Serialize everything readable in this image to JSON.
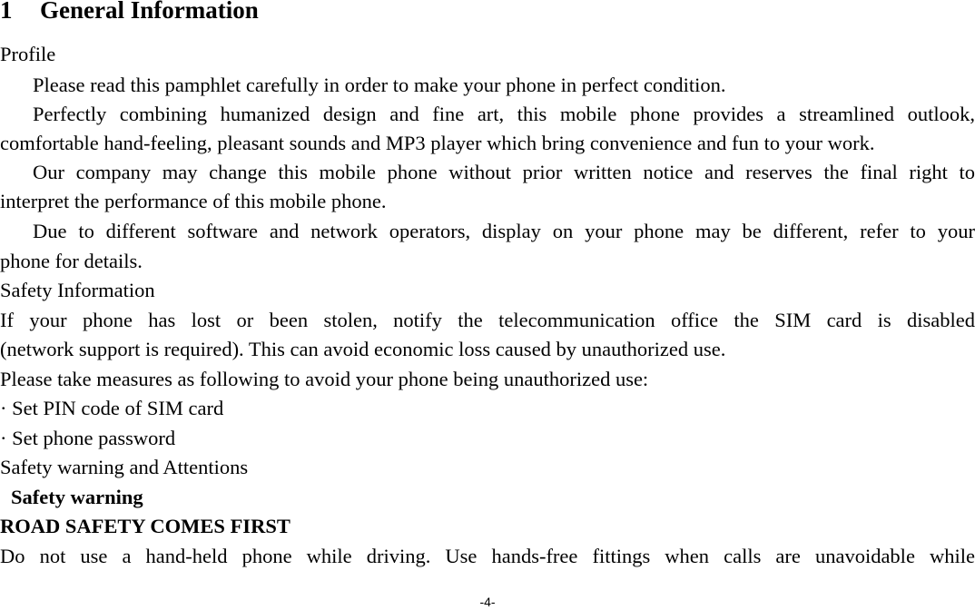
{
  "heading": {
    "number": "1",
    "title": "General Information"
  },
  "lines": [
    "Profile",
    "Please read this pamphlet carefully in order to make your phone in perfect condition.",
    "Perfectly combining humanized design and fine art, this mobile phone provides a streamlined outlook,",
    "comfortable hand-feeling, pleasant sounds and MP3 player which bring convenience and fun to your work.",
    "Our company may change this mobile phone without prior written notice and reserves the final right to",
    "interpret the performance of this mobile phone.",
    "Due to different software and network operators, display on your phone may be different, refer to your",
    "phone for details.",
    "Safety Information",
    "If your phone has lost or been stolen, notify the telecommunication office the SIM card is disabled",
    "(network support is required). This can avoid economic loss caused by unauthorized use.",
    "Please take measures as following to avoid your phone being unauthorized use:",
    "· Set PIN code of SIM card",
    "· Set phone password",
    "Safety warning and Attentions",
    "Safety warning",
    "ROAD SAFETY COMES FIRST",
    "Do not use a hand-held phone while driving. Use hands-free fittings when calls are unavoidable while"
  ],
  "page_number": "-4-"
}
